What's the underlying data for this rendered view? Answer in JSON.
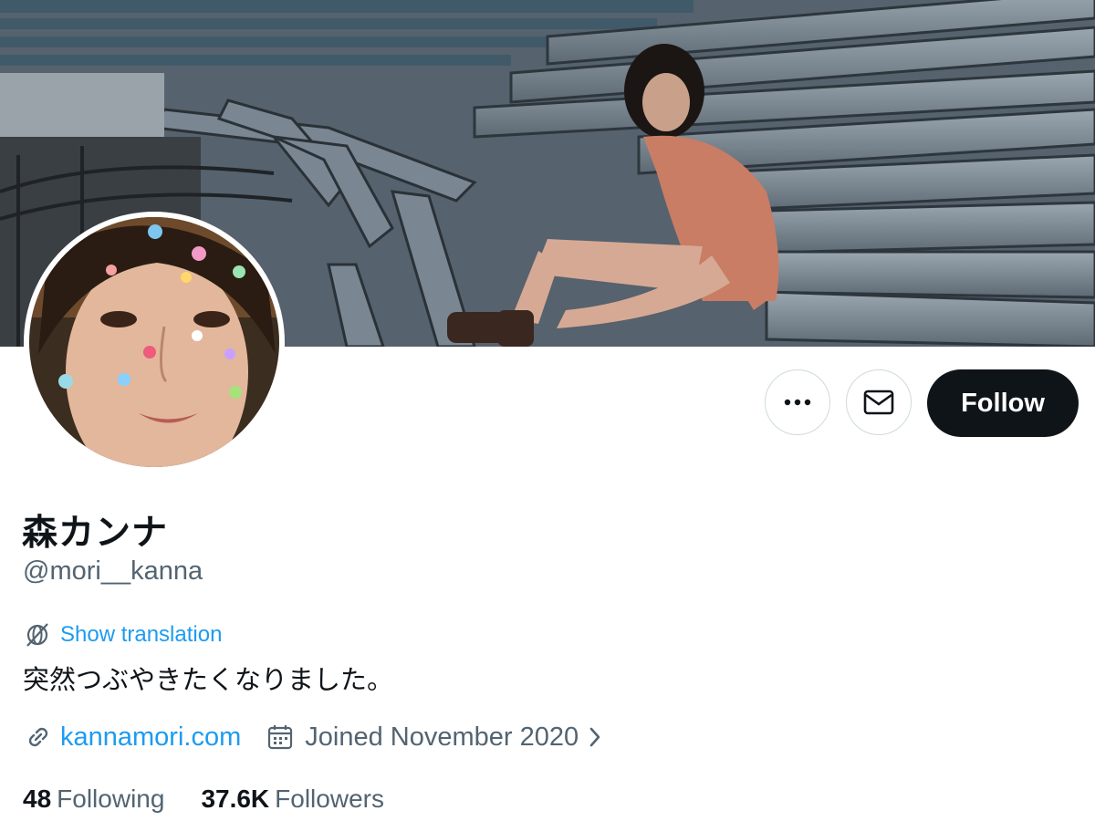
{
  "profile": {
    "display_name": "森カンナ",
    "handle": "@mori__kanna",
    "translation_label": "Show translation",
    "bio": "突然つぶやきたくなりました。",
    "website": "kannamori.com",
    "joined": "Joined November 2020",
    "following_count": "48",
    "following_label": "Following",
    "followers_count": "37.6K",
    "followers_label": "Followers"
  },
  "actions": {
    "follow_label": "Follow",
    "more_icon": "more-horizontal-icon",
    "message_icon": "envelope-icon"
  },
  "icons": {
    "translate": "translate-globe-icon",
    "link": "link-icon",
    "calendar": "calendar-icon",
    "chevron": "chevron-right-icon"
  },
  "colors": {
    "accent": "#1d9bf0",
    "text_primary": "#0f1419",
    "text_secondary": "#536471",
    "follow_button_bg": "#0f1419",
    "border": "#cfd9de"
  }
}
